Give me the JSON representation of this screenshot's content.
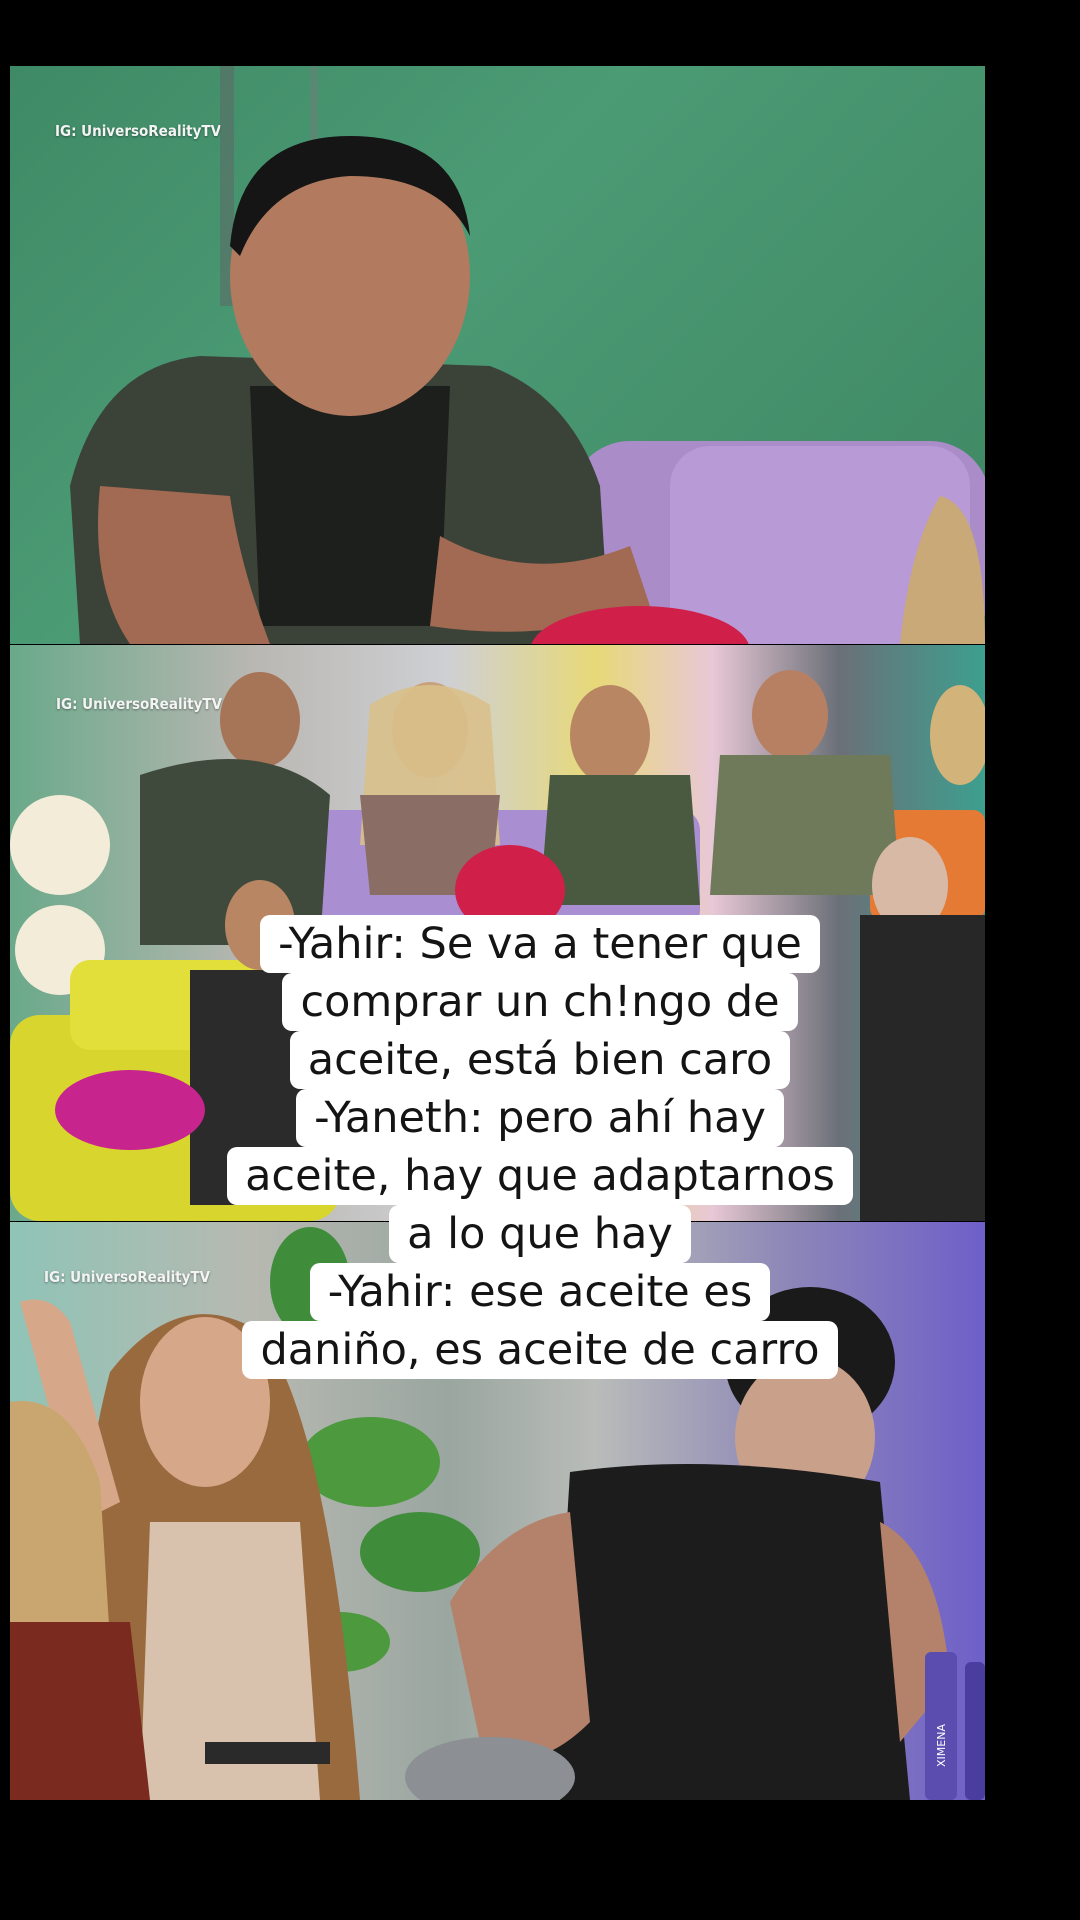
{
  "video": {
    "watermark": "IG: UniversoRealityTV",
    "background_color": "#000000",
    "caption_bg_color": "#ffffff",
    "caption_text_color": "#141414",
    "name_tag": "XIMENA"
  },
  "caption": {
    "lines": [
      "-Yahir: Se va a tener que",
      "comprar un ch!ngo de",
      "aceite, está bien caro",
      "-Yaneth: pero ahí hay",
      "aceite, hay que adaptarnos",
      "a lo que hay",
      "-Yahir: ese aceite es",
      "daniño, es aceite de carro"
    ]
  }
}
